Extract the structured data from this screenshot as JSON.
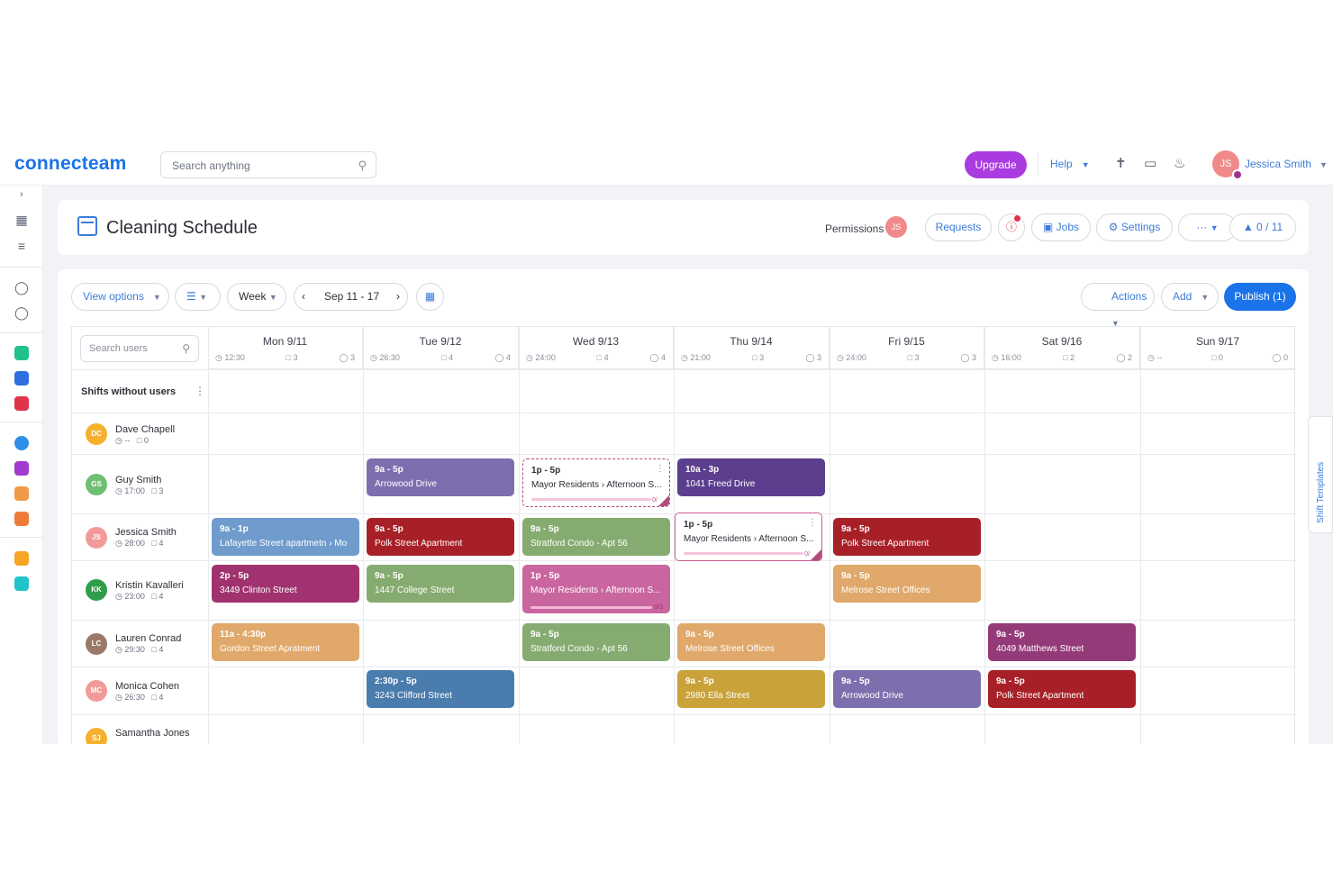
{
  "app": {
    "logo": "connecteam",
    "search_placeholder": "Search anything"
  },
  "topbar": {
    "upgrade": "Upgrade",
    "help": "Help",
    "user": "Jessica Smith",
    "user_initials": "JS"
  },
  "header": {
    "title": "Cleaning Schedule",
    "permissions": "Permissions",
    "permissions_initials": "JS",
    "requests": "Requests",
    "jobs": "Jobs",
    "settings": "Settings",
    "more": "···",
    "progress": "0 / 11"
  },
  "toolbar": {
    "view_options": "View options",
    "week": "Week",
    "date_range": "Sep 11 - 17",
    "actions": "Actions",
    "add": "Add",
    "publish": "Publish (1)"
  },
  "grid": {
    "user_search_placeholder": "Search users",
    "shifts_without_users": "Shifts without users",
    "days": [
      {
        "label": "Mon 9/11",
        "hours": "12:30",
        "shifts": "3",
        "users": "3"
      },
      {
        "label": "Tue 9/12",
        "hours": "26:30",
        "shifts": "4",
        "users": "4"
      },
      {
        "label": "Wed 9/13",
        "hours": "24:00",
        "shifts": "4",
        "users": "4"
      },
      {
        "label": "Thu 9/14",
        "hours": "21:00",
        "shifts": "3",
        "users": "3"
      },
      {
        "label": "Fri 9/15",
        "hours": "24:00",
        "shifts": "3",
        "users": "3"
      },
      {
        "label": "Sat 9/16",
        "hours": "16:00",
        "shifts": "2",
        "users": "2"
      },
      {
        "label": "Sun 9/17",
        "hours": "--",
        "shifts": "0",
        "users": "0"
      }
    ],
    "users": [
      {
        "name": "Dave Chapell",
        "initials": "DC",
        "hours": "--",
        "shifts": "0",
        "color": "#f5b12e"
      },
      {
        "name": "Guy Smith",
        "initials": "GS",
        "hours": "17:00",
        "shifts": "3",
        "color": "#6fbf73"
      },
      {
        "name": "Jessica Smith",
        "initials": "JS",
        "hours": "28:00",
        "shifts": "4",
        "color": "#f29a9a"
      },
      {
        "name": "Kristin Kavalleri",
        "initials": "KK",
        "hours": "23:00",
        "shifts": "4",
        "color": "#2e9e4a"
      },
      {
        "name": "Lauren Conrad",
        "initials": "LC",
        "hours": "29:30",
        "shifts": "4",
        "color": "#9a7a66"
      },
      {
        "name": "Monica Cohen",
        "initials": "MC",
        "hours": "26:30",
        "shifts": "4",
        "color": "#f29a9a"
      },
      {
        "name": "Samantha Jones",
        "initials": "SJ",
        "hours": "",
        "shifts": "",
        "color": "#f5b12e"
      }
    ],
    "shifts": {
      "gs_tue": {
        "time": "9a - 5p",
        "loc": "Arrowood Drive",
        "color": "#7d6fae"
      },
      "gs_wed": {
        "time": "1p - 5p",
        "loc": "Mayor Residents › Afternoon S...",
        "count": "0/"
      },
      "gs_thu": {
        "time": "10a - 3p",
        "loc": "1041 Freed Drive",
        "color": "#5b3f8e"
      },
      "js_mon": {
        "time": "9a - 1p",
        "loc": "Lafayette Street apartmetn › Mo",
        "color": "#6f9ccc"
      },
      "js_tue": {
        "time": "9a - 5p",
        "loc": "Polk Street Apartment",
        "color": "#a82027"
      },
      "js_wed": {
        "time": "9a - 5p",
        "loc": "Stratford Condo - Apt 56",
        "color": "#86ab70"
      },
      "js_thu": {
        "time": "1p - 5p",
        "loc": "Mayor Residents › Afternoon S...",
        "count": "0/"
      },
      "js_fri": {
        "time": "9a - 5p",
        "loc": "Polk Street Apartment",
        "color": "#a82027"
      },
      "kk_mon": {
        "time": "2p - 5p",
        "loc": "3449 Clinton Street",
        "color": "#a0336f"
      },
      "kk_tue": {
        "time": "9a - 5p",
        "loc": "1447 College Street",
        "color": "#86ab70"
      },
      "kk_wed": {
        "time": "1p - 5p",
        "loc": "Mayor Residents › Afternoon S...",
        "color": "#c9669f",
        "count": "0/3"
      },
      "kk_fri": {
        "time": "9a - 5p",
        "loc": "Melrose Street Offices",
        "color": "#e0a86a"
      },
      "lc_mon": {
        "time": "11a - 4:30p",
        "loc": "Gordon Street Apratment",
        "color": "#e0a86a"
      },
      "lc_wed": {
        "time": "9a - 5p",
        "loc": "Stratford Condo - Apt 56",
        "color": "#86ab70"
      },
      "lc_thu": {
        "time": "9a - 5p",
        "loc": "Melrose Street Offices",
        "color": "#e0a86a"
      },
      "lc_sat": {
        "time": "9a - 5p",
        "loc": "4049 Matthews Street",
        "color": "#943a78"
      },
      "mc_tue": {
        "time": "2:30p - 5p",
        "loc": "3243 Clifford Street",
        "color": "#4a7cae"
      },
      "mc_thu": {
        "time": "9a - 5p",
        "loc": "2980 Ella Street",
        "color": "#c9a23a"
      },
      "mc_fri": {
        "time": "9a - 5p",
        "loc": "Arrowood Drive",
        "color": "#7d6fae"
      },
      "mc_sat": {
        "time": "9a - 5p",
        "loc": "Polk Street Apartment",
        "color": "#a82027"
      }
    }
  },
  "side_panel": {
    "shift_templates": "Shift Templates"
  }
}
